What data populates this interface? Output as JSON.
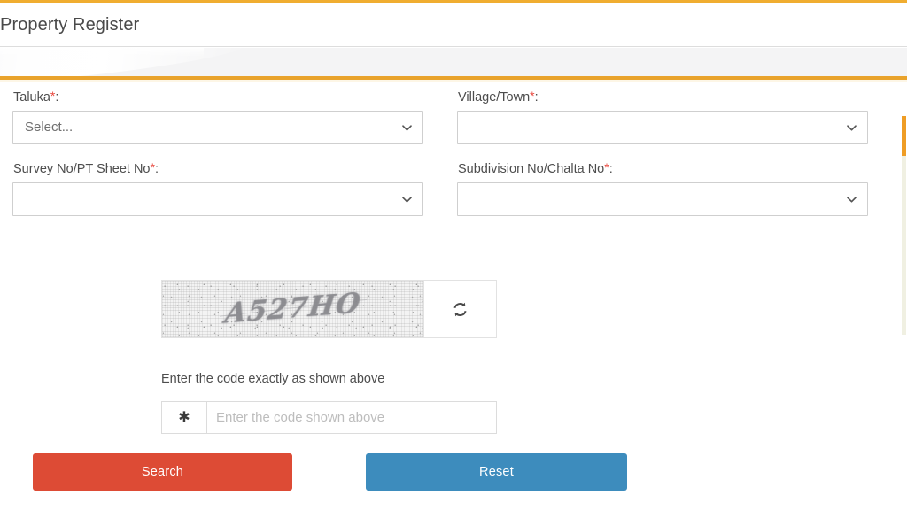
{
  "theme": {
    "accent_orange": "#f0ad30",
    "band_orange": "#e9a32c",
    "search_red": "#dd4b35",
    "reset_blue": "#3d8cbd",
    "required_red": "#e8463c",
    "label_gray": "#4d4d4d",
    "band_gray": "#f4f4f5",
    "border_gray": "#cfcfcf"
  },
  "header": {
    "title": "Property Register"
  },
  "form": {
    "rows": [
      {
        "left": {
          "label": "Taluka",
          "required_mark": "*",
          "colon": ":",
          "value": "Select...",
          "empty": false,
          "icon": "chevron-down-icon"
        },
        "right": {
          "label": "Village/Town",
          "required_mark": "*",
          "colon": ":",
          "value": "",
          "empty": true,
          "icon": "chevron-down-icon"
        }
      },
      {
        "left": {
          "label": "Survey No/PT Sheet No",
          "required_mark": "*",
          "colon": ":",
          "value": "",
          "empty": true,
          "icon": "chevron-down-icon"
        },
        "right": {
          "label": "Subdivision No/Chalta No",
          "required_mark": "*",
          "colon": ":",
          "value": "",
          "empty": true,
          "icon": "chevron-down-icon"
        }
      }
    ]
  },
  "captcha": {
    "code_text": "A527HO",
    "refresh_icon": "refresh-icon",
    "hint": "Enter the code exactly as shown above",
    "addon_icon": "asterisk-icon",
    "addon_glyph": "✱",
    "input_value": "",
    "input_placeholder": "Enter the code shown above"
  },
  "actions": {
    "search_label": "Search",
    "reset_label": "Reset"
  },
  "scroll": {
    "orientation": "vertical",
    "thumb_color": "#ef9d25"
  }
}
